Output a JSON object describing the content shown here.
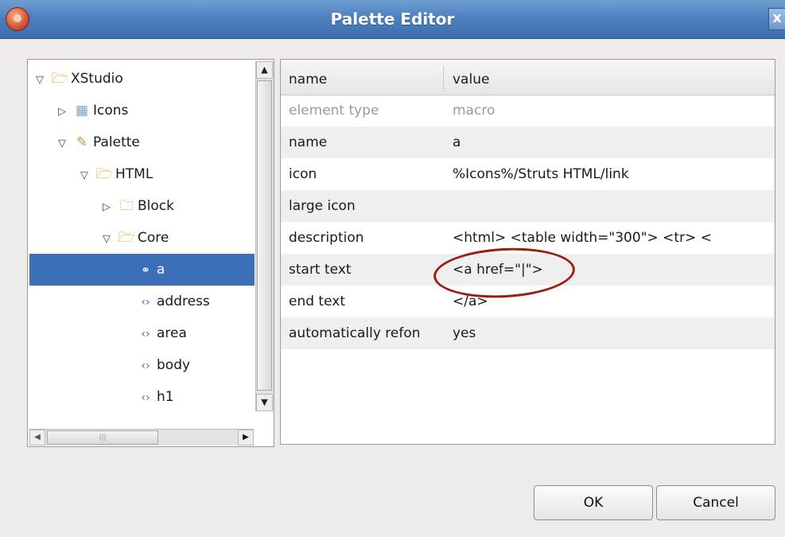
{
  "window": {
    "title": "Palette Editor",
    "close_label": "x"
  },
  "tree": {
    "items": [
      {
        "label": "XStudio",
        "twisty": "▽",
        "icon": "open-folder-icon"
      },
      {
        "label": "Icons",
        "twisty": "▷",
        "icon": "icons-group-icon"
      },
      {
        "label": "Palette",
        "twisty": "▽",
        "icon": "palette-icon"
      },
      {
        "label": "HTML",
        "twisty": "▽",
        "icon": "open-folder-icon"
      },
      {
        "label": "Block",
        "twisty": "▷",
        "icon": "folder-icon"
      },
      {
        "label": "Core",
        "twisty": "▽",
        "icon": "open-folder-icon"
      },
      {
        "label": "a",
        "twisty": "",
        "icon": "link-icon",
        "selected": true
      },
      {
        "label": "address",
        "twisty": "",
        "icon": "tag-icon"
      },
      {
        "label": "area",
        "twisty": "",
        "icon": "tag-icon"
      },
      {
        "label": "body",
        "twisty": "",
        "icon": "tag-icon"
      },
      {
        "label": "h1",
        "twisty": "",
        "icon": "tag-icon"
      }
    ]
  },
  "properties": {
    "columns": {
      "name": "name",
      "value": "value"
    },
    "rows": [
      {
        "key": "element type",
        "value": "macro",
        "disabled": true
      },
      {
        "key": "name",
        "value": "a"
      },
      {
        "key": "icon",
        "value": "%Icons%/Struts HTML/link"
      },
      {
        "key": "large icon",
        "value": ""
      },
      {
        "key": "description",
        "value": "<html>  <table width=\"300\">  <tr>  <"
      },
      {
        "key": "start text",
        "value": "<a href=\"|\">"
      },
      {
        "key": "end text",
        "value": "</a>"
      },
      {
        "key": "automatically refon",
        "value": "yes"
      }
    ]
  },
  "buttons": {
    "ok": "OK",
    "cancel": "Cancel"
  },
  "colors": {
    "title_bar": "#4f80bd",
    "selection": "#3b70b9",
    "annotation": "#9a1f12"
  }
}
